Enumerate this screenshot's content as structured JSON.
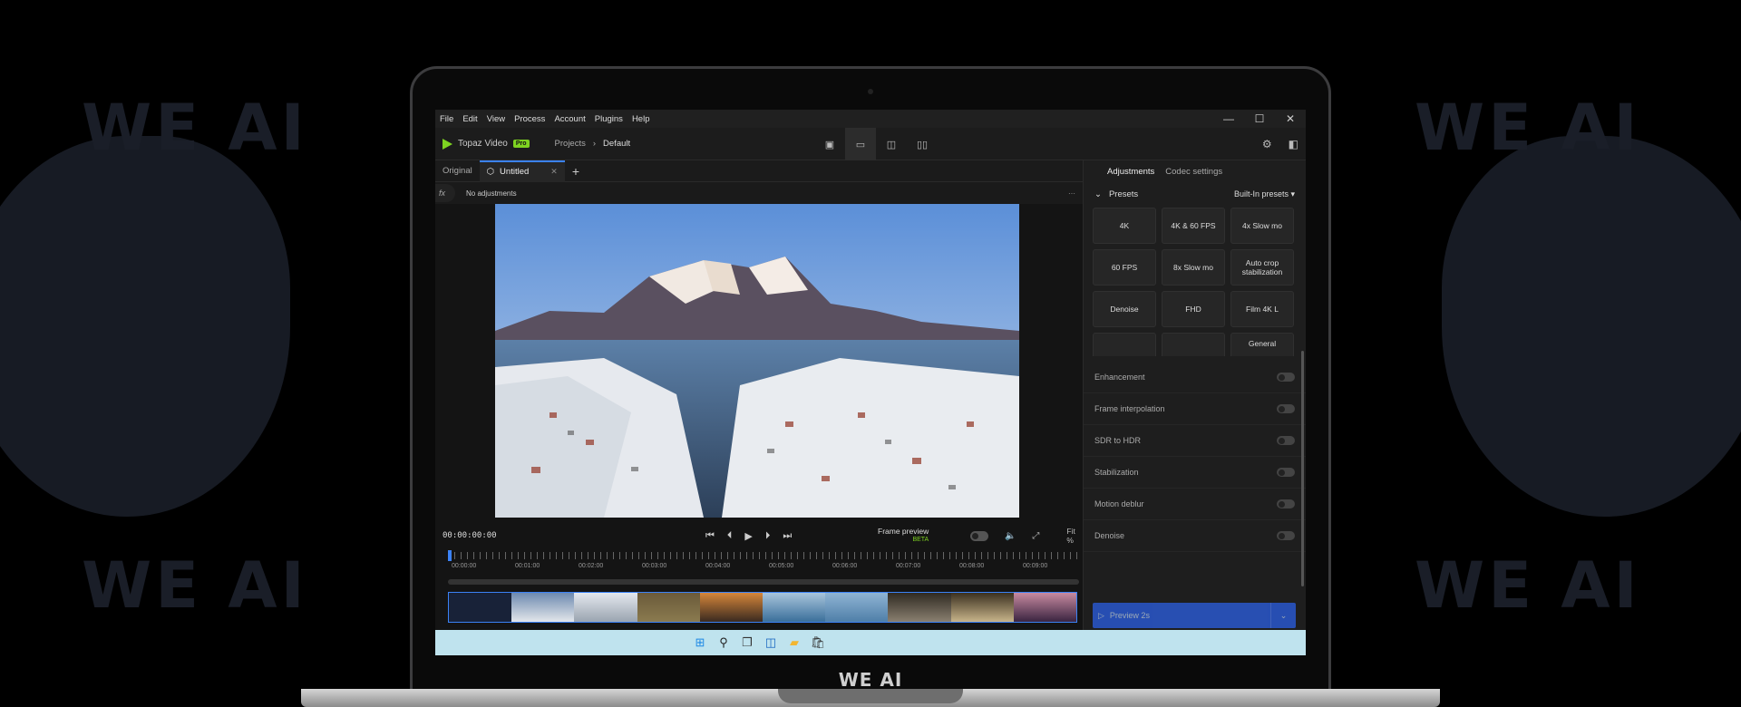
{
  "menu": [
    "File",
    "Edit",
    "View",
    "Process",
    "Account",
    "Plugins",
    "Help"
  ],
  "app": {
    "name": "Topaz Video",
    "badge": "Pro"
  },
  "breadcrumb": {
    "root": "Projects",
    "current": "Default"
  },
  "tabs": {
    "original": "Original",
    "active": "Untitled"
  },
  "adjustments_label": "No adjustments",
  "fx_label": "fx",
  "timecode": "00:00:00:00",
  "frame_preview": {
    "label": "Frame preview",
    "badge": "BETA"
  },
  "zoom": "Fit %",
  "ruler": [
    "00:00:00",
    "00:01:00",
    "00:02:00",
    "00:03:00",
    "00:04:00",
    "00:05:00",
    "00:06:00",
    "00:07:00",
    "00:08:00",
    "00:09:00"
  ],
  "panel": {
    "tabs": [
      "Adjustments",
      "Codec settings"
    ],
    "presets_title": "Presets",
    "presets_source": "Built-In presets",
    "presets": [
      "4K",
      "4K & 60 FPS",
      "4x Slow mo",
      "60 FPS",
      "8x Slow mo",
      "Auto crop stabilization",
      "Denoise",
      "FHD",
      "Film 4K L",
      "",
      "",
      "General"
    ],
    "features": [
      "Enhancement",
      "Frame interpolation",
      "SDR to HDR",
      "Stabilization",
      "Motion deblur",
      "Denoise"
    ],
    "preview_button": "Preview 2s"
  },
  "watermark": "WE AI",
  "brand": "WE AI",
  "colors": {
    "accent": "#3b82f6",
    "brand_green": "#7ed321",
    "taskbar": "#bfe3ee"
  }
}
